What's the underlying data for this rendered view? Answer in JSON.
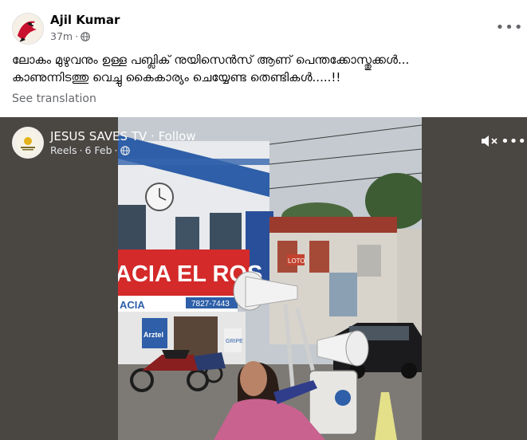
{
  "post": {
    "author": "Ajil Kumar",
    "time": "37m",
    "separator": "·",
    "audience_icon": "globe-icon",
    "more_icon": "more-horizontal-icon",
    "more_label": "•••",
    "text_line1": "ലോകം മുഴുവനും ഉള്ള പബ്ലിക് നുയിസെൻസ് ആണ് പെന്തക്കോസ്തുക്കൾ...",
    "text_line2": "കാണുന്നിടത്തു വെച്ചു കൈകാര്യം ചെയ്യേണ്ട തെണ്ടികൾ.....!!",
    "see_translation": "See translation"
  },
  "reel": {
    "page_name": "JESUS SAVES TV",
    "follow_separator": " · ",
    "follow_label": "Follow",
    "type": "Reels",
    "date": "6 Feb",
    "separator": "·",
    "audience_icon": "globe-icon",
    "mute_icon": "speaker-muted-icon",
    "more_icon": "more-horizontal-icon",
    "more_label": "•••",
    "video_signs": {
      "pharmacy": "ACIA EL ROS",
      "pharmacy_lower": "ACIA",
      "phone": "7827-7443",
      "brand": "Arztel",
      "side_sign": "LOTO",
      "shop_label": "GRIPE"
    }
  },
  "colors": {
    "text_primary": "#050505",
    "text_secondary": "#65676b",
    "reel_bg": "#4a4743",
    "pharmacy_red": "#d42a2a",
    "wall_blue": "#2e5fa8"
  }
}
